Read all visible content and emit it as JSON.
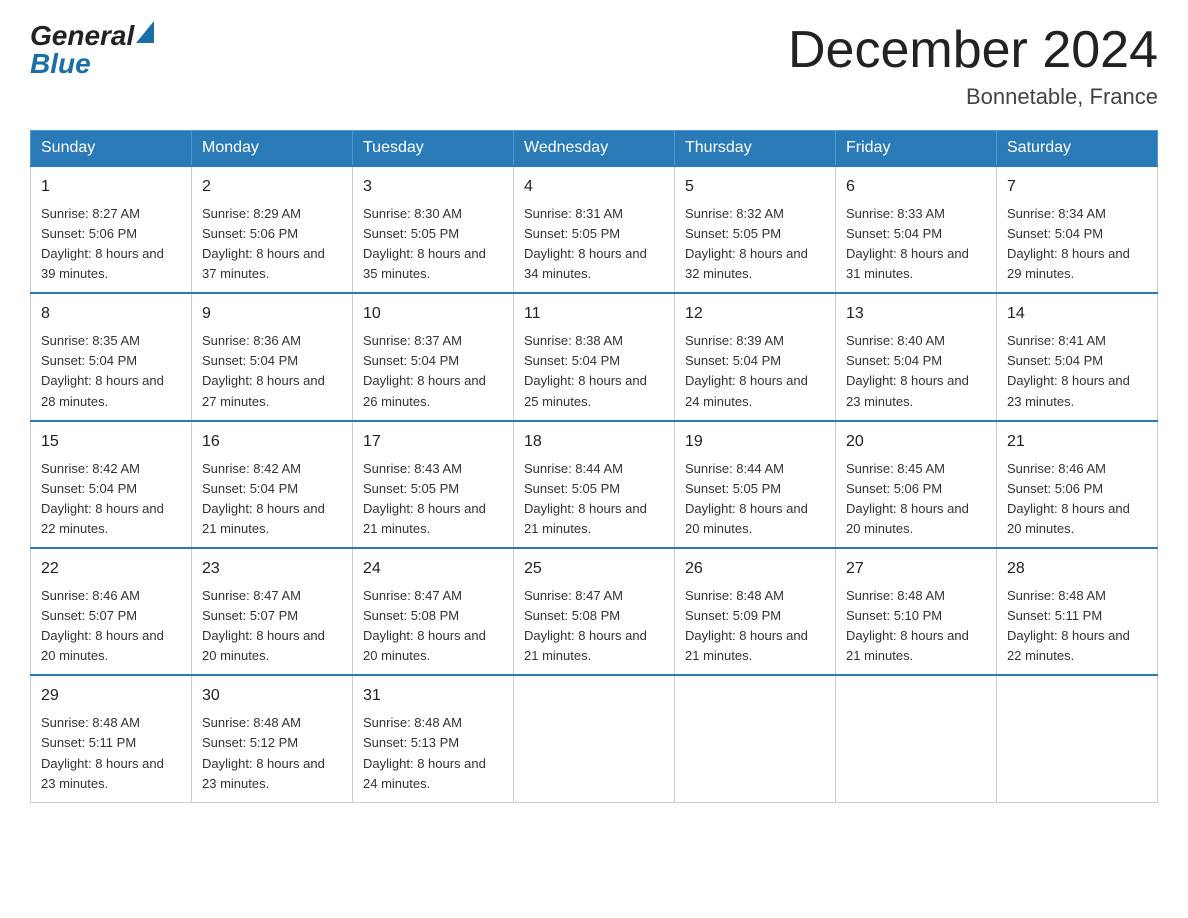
{
  "header": {
    "logo_general": "General",
    "logo_blue": "Blue",
    "month_year": "December 2024",
    "location": "Bonnetable, France"
  },
  "days_of_week": [
    "Sunday",
    "Monday",
    "Tuesday",
    "Wednesday",
    "Thursday",
    "Friday",
    "Saturday"
  ],
  "weeks": [
    [
      {
        "day": "1",
        "sunrise": "8:27 AM",
        "sunset": "5:06 PM",
        "daylight": "8 hours and 39 minutes."
      },
      {
        "day": "2",
        "sunrise": "8:29 AM",
        "sunset": "5:06 PM",
        "daylight": "8 hours and 37 minutes."
      },
      {
        "day": "3",
        "sunrise": "8:30 AM",
        "sunset": "5:05 PM",
        "daylight": "8 hours and 35 minutes."
      },
      {
        "day": "4",
        "sunrise": "8:31 AM",
        "sunset": "5:05 PM",
        "daylight": "8 hours and 34 minutes."
      },
      {
        "day": "5",
        "sunrise": "8:32 AM",
        "sunset": "5:05 PM",
        "daylight": "8 hours and 32 minutes."
      },
      {
        "day": "6",
        "sunrise": "8:33 AM",
        "sunset": "5:04 PM",
        "daylight": "8 hours and 31 minutes."
      },
      {
        "day": "7",
        "sunrise": "8:34 AM",
        "sunset": "5:04 PM",
        "daylight": "8 hours and 29 minutes."
      }
    ],
    [
      {
        "day": "8",
        "sunrise": "8:35 AM",
        "sunset": "5:04 PM",
        "daylight": "8 hours and 28 minutes."
      },
      {
        "day": "9",
        "sunrise": "8:36 AM",
        "sunset": "5:04 PM",
        "daylight": "8 hours and 27 minutes."
      },
      {
        "day": "10",
        "sunrise": "8:37 AM",
        "sunset": "5:04 PM",
        "daylight": "8 hours and 26 minutes."
      },
      {
        "day": "11",
        "sunrise": "8:38 AM",
        "sunset": "5:04 PM",
        "daylight": "8 hours and 25 minutes."
      },
      {
        "day": "12",
        "sunrise": "8:39 AM",
        "sunset": "5:04 PM",
        "daylight": "8 hours and 24 minutes."
      },
      {
        "day": "13",
        "sunrise": "8:40 AM",
        "sunset": "5:04 PM",
        "daylight": "8 hours and 23 minutes."
      },
      {
        "day": "14",
        "sunrise": "8:41 AM",
        "sunset": "5:04 PM",
        "daylight": "8 hours and 23 minutes."
      }
    ],
    [
      {
        "day": "15",
        "sunrise": "8:42 AM",
        "sunset": "5:04 PM",
        "daylight": "8 hours and 22 minutes."
      },
      {
        "day": "16",
        "sunrise": "8:42 AM",
        "sunset": "5:04 PM",
        "daylight": "8 hours and 21 minutes."
      },
      {
        "day": "17",
        "sunrise": "8:43 AM",
        "sunset": "5:05 PM",
        "daylight": "8 hours and 21 minutes."
      },
      {
        "day": "18",
        "sunrise": "8:44 AM",
        "sunset": "5:05 PM",
        "daylight": "8 hours and 21 minutes."
      },
      {
        "day": "19",
        "sunrise": "8:44 AM",
        "sunset": "5:05 PM",
        "daylight": "8 hours and 20 minutes."
      },
      {
        "day": "20",
        "sunrise": "8:45 AM",
        "sunset": "5:06 PM",
        "daylight": "8 hours and 20 minutes."
      },
      {
        "day": "21",
        "sunrise": "8:46 AM",
        "sunset": "5:06 PM",
        "daylight": "8 hours and 20 minutes."
      }
    ],
    [
      {
        "day": "22",
        "sunrise": "8:46 AM",
        "sunset": "5:07 PM",
        "daylight": "8 hours and 20 minutes."
      },
      {
        "day": "23",
        "sunrise": "8:47 AM",
        "sunset": "5:07 PM",
        "daylight": "8 hours and 20 minutes."
      },
      {
        "day": "24",
        "sunrise": "8:47 AM",
        "sunset": "5:08 PM",
        "daylight": "8 hours and 20 minutes."
      },
      {
        "day": "25",
        "sunrise": "8:47 AM",
        "sunset": "5:08 PM",
        "daylight": "8 hours and 21 minutes."
      },
      {
        "day": "26",
        "sunrise": "8:48 AM",
        "sunset": "5:09 PM",
        "daylight": "8 hours and 21 minutes."
      },
      {
        "day": "27",
        "sunrise": "8:48 AM",
        "sunset": "5:10 PM",
        "daylight": "8 hours and 21 minutes."
      },
      {
        "day": "28",
        "sunrise": "8:48 AM",
        "sunset": "5:11 PM",
        "daylight": "8 hours and 22 minutes."
      }
    ],
    [
      {
        "day": "29",
        "sunrise": "8:48 AM",
        "sunset": "5:11 PM",
        "daylight": "8 hours and 23 minutes."
      },
      {
        "day": "30",
        "sunrise": "8:48 AM",
        "sunset": "5:12 PM",
        "daylight": "8 hours and 23 minutes."
      },
      {
        "day": "31",
        "sunrise": "8:48 AM",
        "sunset": "5:13 PM",
        "daylight": "8 hours and 24 minutes."
      },
      null,
      null,
      null,
      null
    ]
  ]
}
